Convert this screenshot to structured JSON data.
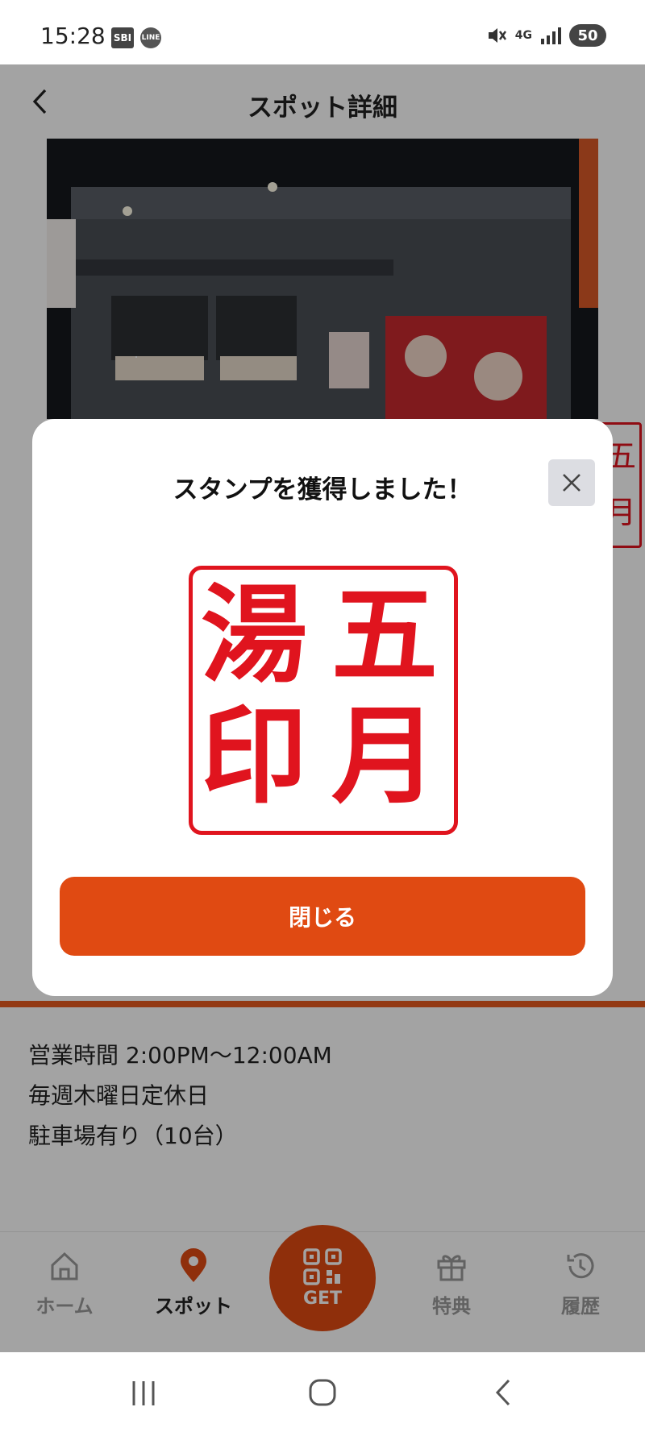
{
  "status_bar": {
    "time": "15:28",
    "app_badges": [
      "SBI",
      "LINE"
    ],
    "network": "4G",
    "battery": "50"
  },
  "header": {
    "title": "スポット詳細"
  },
  "spot": {
    "hours": "営業時間 2:00PM〜12:00AM",
    "holiday": "毎週木曜日定休日",
    "parking": "駐車場有り（10台）"
  },
  "modal": {
    "title": "スタンプを獲得しました！",
    "stamp_chars": [
      "五",
      "月",
      "湯",
      "印"
    ],
    "close_label": "閉じる"
  },
  "bottom_nav": {
    "items": [
      {
        "label": "ホーム",
        "icon": "home-icon",
        "active": false
      },
      {
        "label": "スポット",
        "icon": "map-pin-icon",
        "active": true
      },
      {
        "label": "特典",
        "icon": "gift-icon",
        "active": false
      },
      {
        "label": "履歴",
        "icon": "history-icon",
        "active": false
      }
    ],
    "get_label": "GET"
  },
  "colors": {
    "accent": "#e04a12",
    "stamp_red": "#e0141e"
  }
}
